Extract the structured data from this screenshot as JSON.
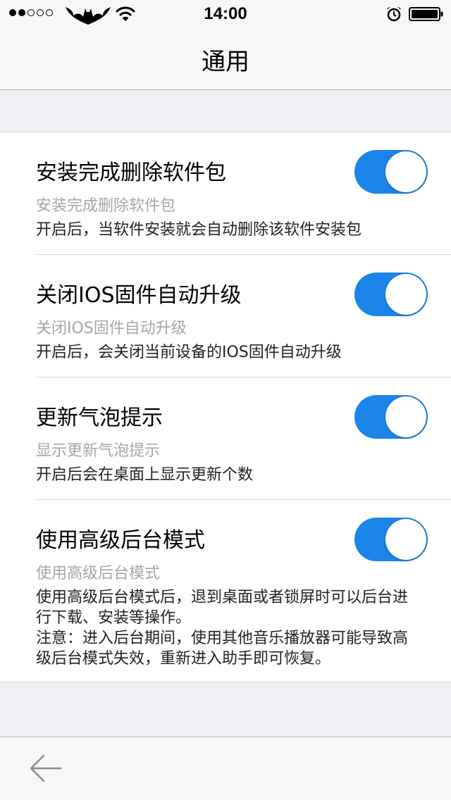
{
  "status_bar": {
    "time": "14:00",
    "signal_bars_filled": 2,
    "signal_bars_total": 5,
    "carrier_icon": "batman-logo-icon",
    "wifi_icon": "wifi-icon",
    "alarm_icon": "alarm-clock-icon",
    "battery_icon": "battery-icon"
  },
  "nav": {
    "title": "通用"
  },
  "settings": [
    {
      "title": "安装完成删除软件包",
      "subtitle": "安装完成删除软件包",
      "description": "开启后，当软件安装就会自动删除该软件安装包",
      "enabled": true
    },
    {
      "title": "关闭IOS固件自动升级",
      "subtitle": "关闭IOS固件自动升级",
      "description": "开启后，会关闭当前设备的IOS固件自动升级",
      "enabled": true
    },
    {
      "title": "更新气泡提示",
      "subtitle": "显示更新气泡提示",
      "description": "开启后会在桌面上显示更新个数",
      "enabled": true
    },
    {
      "title": "使用高级后台模式",
      "subtitle": "使用高级后台模式",
      "description": "使用高级后台模式后，退到桌面或者锁屏时可以后台进行下载、安装等操作。\n注意：进入后台期间，使用其他音乐播放器可能导致高级后台模式失效，重新进入助手即可恢复。",
      "enabled": true
    }
  ],
  "toolbar": {
    "back_icon": "back-arrow-icon"
  },
  "colors": {
    "accent": "#1a84e8",
    "background": "#efeff4",
    "bar": "#f7f7f7",
    "subtitle": "#a6a6a6"
  }
}
